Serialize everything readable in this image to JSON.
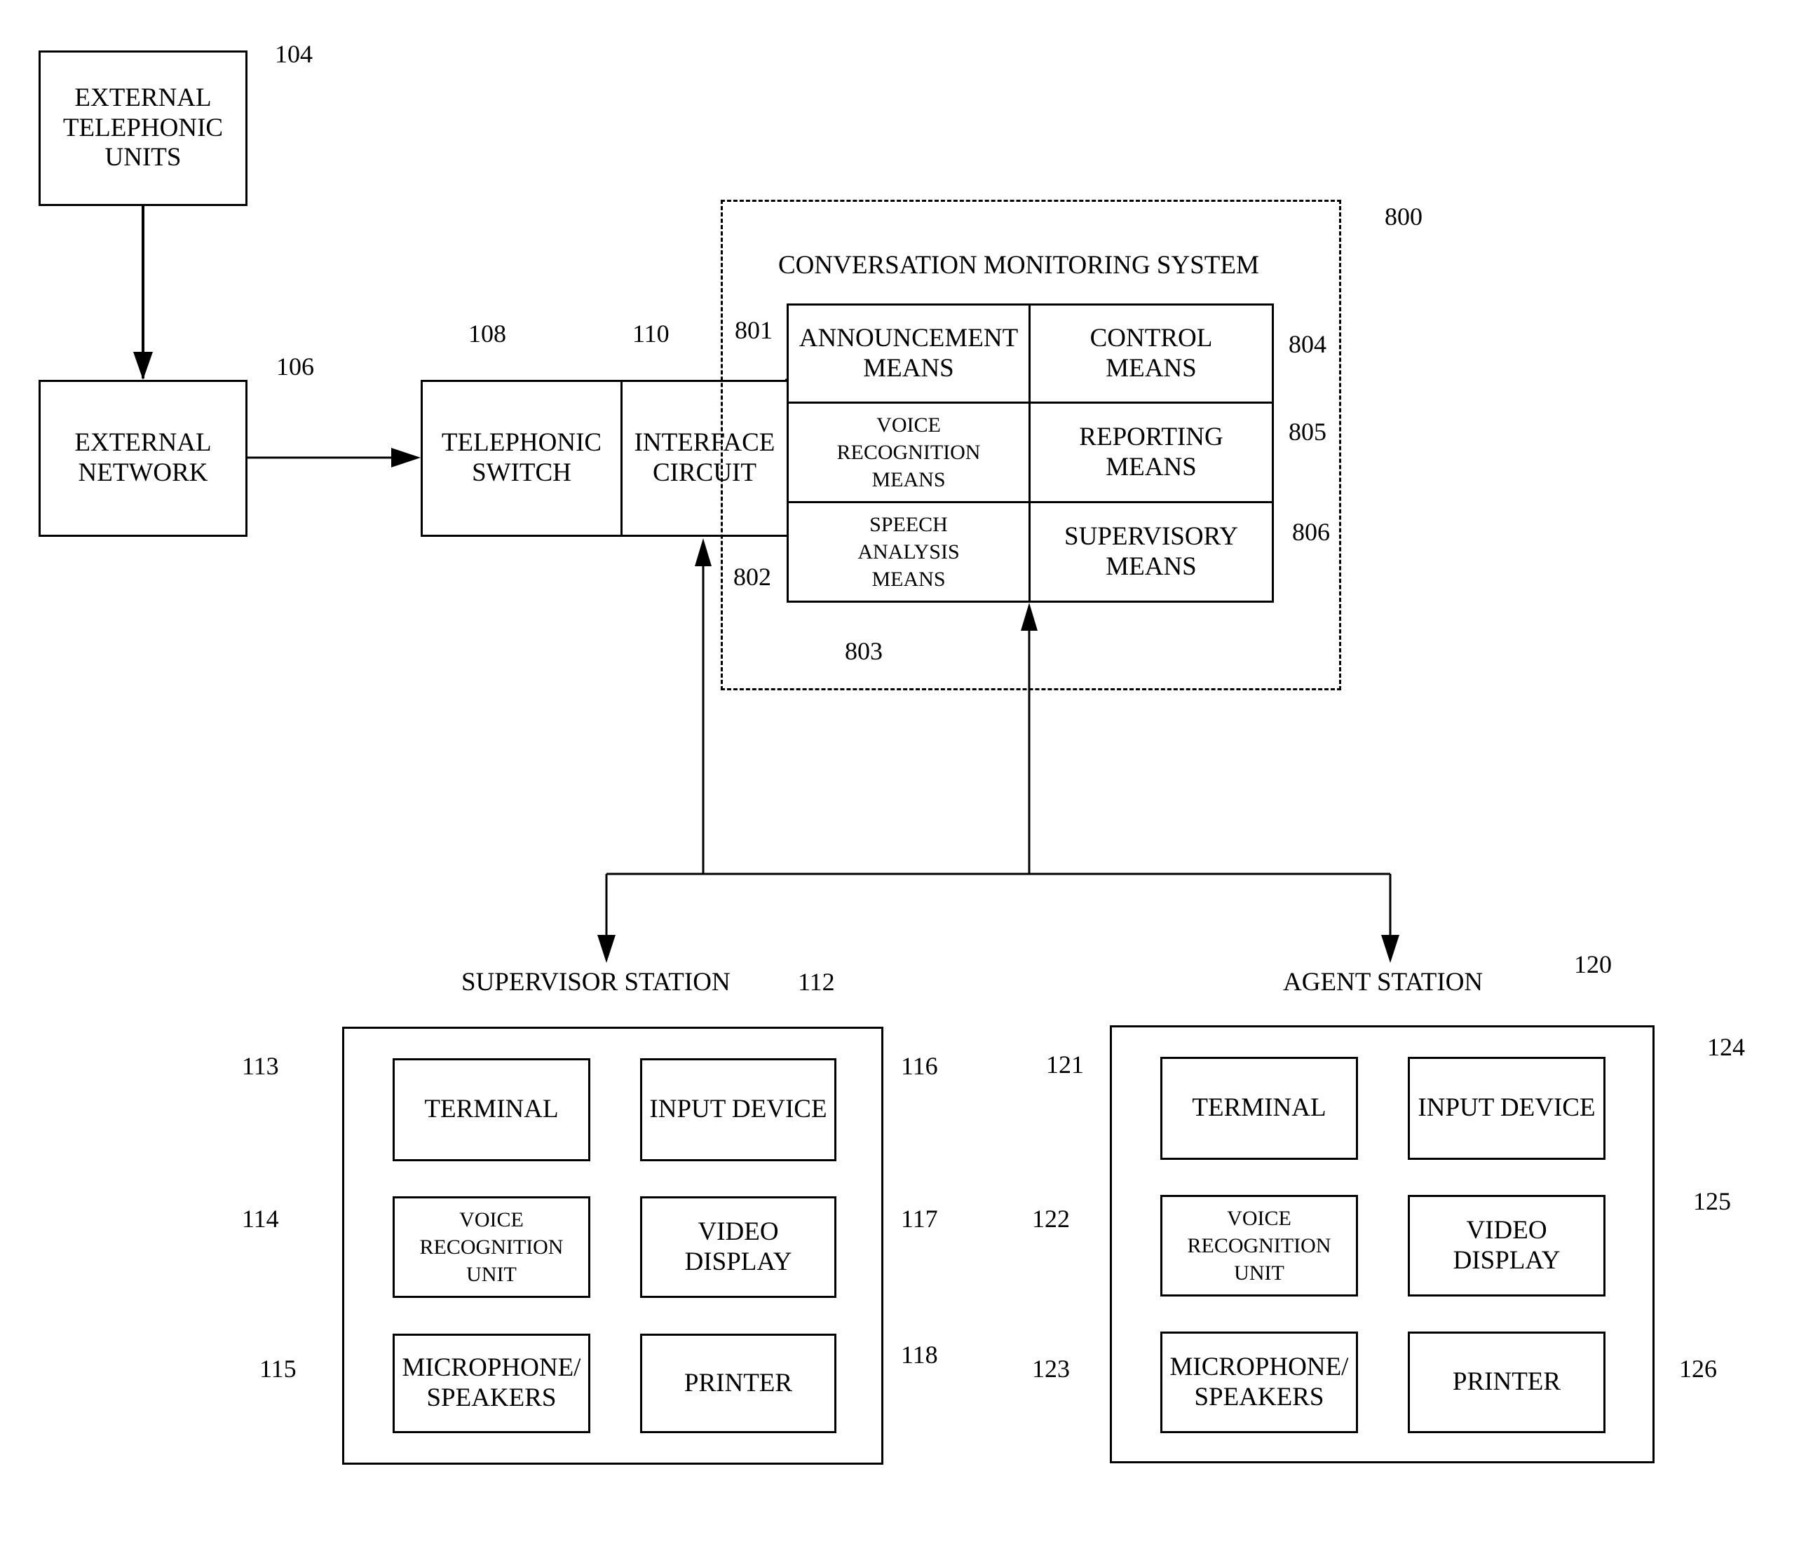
{
  "external_units": {
    "label": "EXTERNAL\nTELEPHONIC\nUNITS",
    "ref": "104"
  },
  "external_network": {
    "label": "EXTERNAL\nNETWORK",
    "ref": "106"
  },
  "telephonic_switch": {
    "label": "TELEPHONIC\nSWITCH",
    "ref": "108"
  },
  "interface_circuit": {
    "label": "INTERFACE\nCIRCUIT",
    "ref": "110"
  },
  "cms": {
    "title": "CONVERSATION MONITORING SYSTEM",
    "ref": "800",
    "refs": {
      "r801": "801",
      "r802": "802",
      "r803": "803",
      "r804": "804",
      "r805": "805",
      "r806": "806"
    },
    "cells": {
      "announcement": "ANNOUNCEMENT\nMEANS",
      "control": "CONTROL\nMEANS",
      "voice": "VOICE\nRECOGNITION\nMEANS",
      "reporting": "REPORTING\nMEANS",
      "speech": "SPEECH\nANALYSIS\nMEANS",
      "supervisory": "SUPERVISORY\nMEANS"
    }
  },
  "supervisor": {
    "title": "SUPERVISOR STATION",
    "ref": "112",
    "items": {
      "terminal": {
        "label": "TERMINAL",
        "ref": "113"
      },
      "voice": {
        "label": "VOICE\nRECOGNITION\nUNIT",
        "ref": "114"
      },
      "mic": {
        "label": "MICROPHONE/\nSPEAKERS",
        "ref": "115"
      },
      "input": {
        "label": "INPUT DEVICE",
        "ref": "116"
      },
      "video": {
        "label": "VIDEO\nDISPLAY",
        "ref": "117"
      },
      "printer": {
        "label": "PRINTER",
        "ref": "118"
      }
    }
  },
  "agent": {
    "title": "AGENT STATION",
    "ref": "120",
    "items": {
      "terminal": {
        "label": "TERMINAL",
        "ref": "121"
      },
      "voice": {
        "label": "VOICE\nRECOGNITION\nUNIT",
        "ref": "122"
      },
      "mic": {
        "label": "MICROPHONE/\nSPEAKERS",
        "ref": "123"
      },
      "input": {
        "label": "INPUT DEVICE",
        "ref": "124"
      },
      "video": {
        "label": "VIDEO\nDISPLAY",
        "ref": "125"
      },
      "printer": {
        "label": "PRINTER",
        "ref": "126"
      }
    }
  }
}
